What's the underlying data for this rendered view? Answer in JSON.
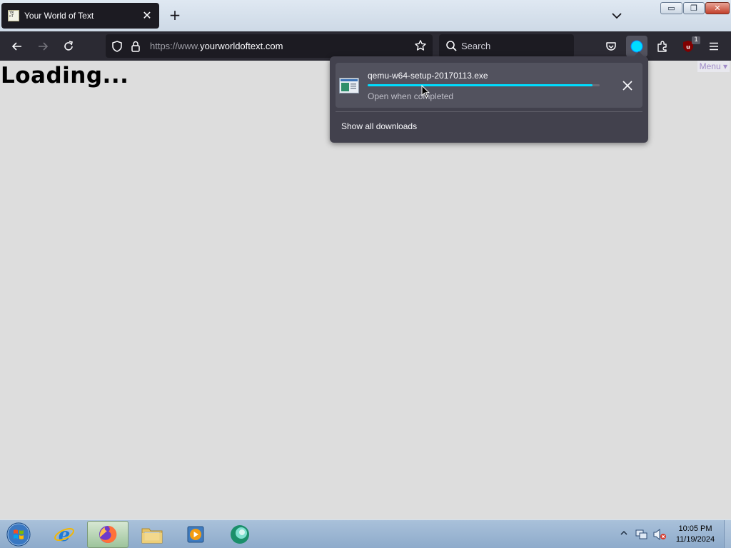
{
  "browser": {
    "tab": {
      "title": "Your World of Text",
      "favicon_text": "YWoT"
    },
    "window_controls": {
      "minimize": "▭",
      "maximize": "❐",
      "close": "✕"
    },
    "url": {
      "prefix": "https://www.",
      "domain": "yourworldoftext.com"
    },
    "search_placeholder": "Search",
    "extension_badge": "1"
  },
  "page": {
    "heading": "Loading...",
    "menu_link": "Menu ▾"
  },
  "downloads": {
    "file_name": "qemu-w64-setup-20170113.exe",
    "progress_percent": 97,
    "status": "Open when completed",
    "show_all": "Show all downloads"
  },
  "taskbar": {
    "time": "10:05 PM",
    "date": "11/19/2024"
  },
  "colors": {
    "accent": "#00ddff",
    "panel": "#42414d",
    "toolbar": "#2b2a33",
    "page_bg": "#dddddd"
  }
}
